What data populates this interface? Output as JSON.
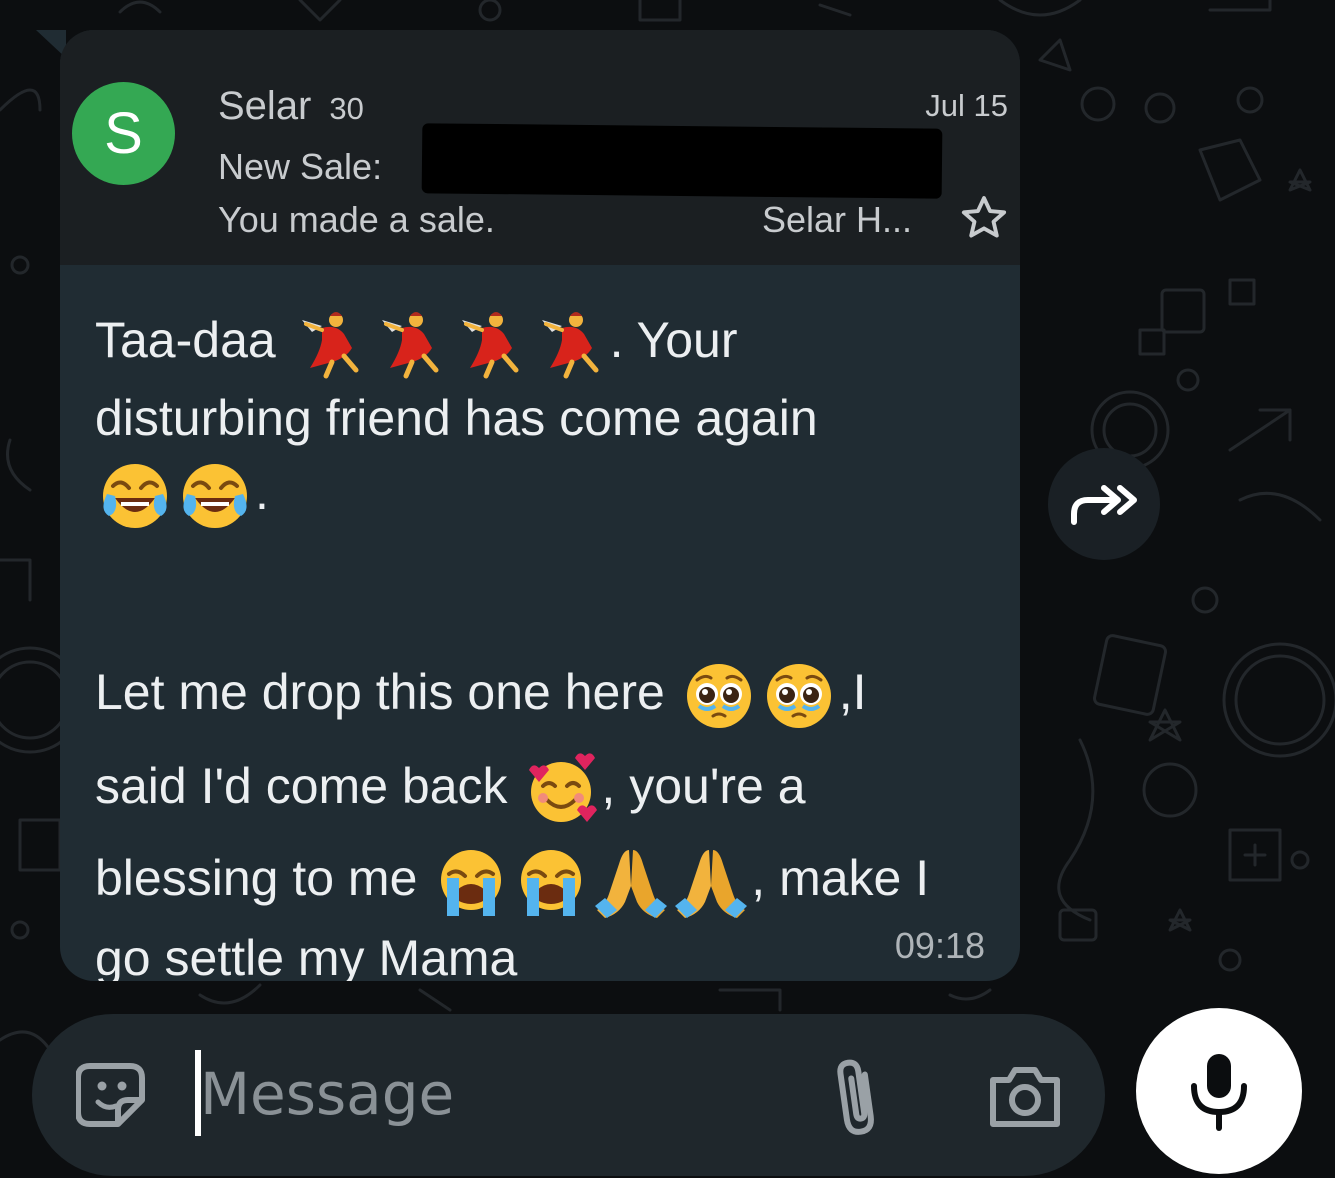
{
  "email_preview": {
    "avatar_letter": "S",
    "sender": "Selar",
    "thread_count": "30",
    "date": "Jul 15",
    "subject_prefix": "New Sale:",
    "snippet": "You made a sale.",
    "label": "Selar H...",
    "star_icon": "star-outline-icon"
  },
  "message": {
    "lines": [
      {
        "before": "Taa-daa",
        "emojis": [
          "woman-dancing",
          "woman-dancing",
          "woman-dancing",
          "woman-dancing"
        ],
        "after": ". Your"
      },
      {
        "before": "disturbing friend has come again",
        "emojis": [],
        "after": ""
      },
      {
        "before": "",
        "emojis": [
          "tears-of-joy",
          "tears-of-joy"
        ],
        "after": "."
      },
      {
        "before": "Let me drop this one here",
        "emojis": [
          "pleading-face",
          "pleading-face"
        ],
        "after": ",I"
      },
      {
        "before": "said I'd come back",
        "emojis": [
          "smiling-face-with-hearts"
        ],
        "after": ", you're a"
      },
      {
        "before": "blessing to me",
        "emojis": [
          "loudly-crying",
          "loudly-crying",
          "folded-hands",
          "folded-hands"
        ],
        "after": ", make I"
      },
      {
        "before": "go settle my Mama",
        "emojis": [],
        "after": ""
      }
    ],
    "time": "09:18"
  },
  "composer": {
    "placeholder": "Message",
    "value": ""
  },
  "icons": {
    "forward": "forward-icon",
    "sticker": "sticker-icon",
    "attach": "paperclip-icon",
    "camera": "camera-icon",
    "mic": "microphone-icon"
  },
  "colors": {
    "bubble": "#202c33",
    "avatar": "#34a853",
    "background": "#0c0e10"
  }
}
